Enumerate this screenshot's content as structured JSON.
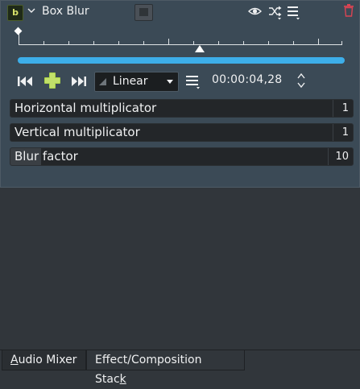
{
  "effect": {
    "badge": "b",
    "title": "Box Blur"
  },
  "keyframes": {
    "interpolation": "Linear",
    "timecode": "00:00:04,28",
    "position_fraction": 0.56
  },
  "params": [
    {
      "name": "Horizontal multiplicator",
      "value": "1",
      "fraction": 0.0
    },
    {
      "name": "Vertical multiplicator",
      "value": "1",
      "fraction": 0.0
    },
    {
      "name": "Blur factor",
      "value": "10",
      "fraction": 0.09
    }
  ],
  "tabs": [
    {
      "label": "Audio Mixer",
      "accel": "A",
      "rest": "udio Mixer"
    },
    {
      "label": "Effect/Composition Stack",
      "prefix": "Effect/Composition Stac",
      "accel": "k"
    }
  ],
  "colors": {
    "panel": "#3b4a56",
    "accent": "#3daee9",
    "background": "#31363b"
  },
  "icons": {
    "collapse": "chevron-down-icon",
    "compare": "compare-split-icon",
    "visibility": "eye-icon",
    "presets": "shuffle-icon",
    "menu": "hamburger-menu-icon",
    "delete": "trash-icon",
    "prev_keyframe": "previous-keyframe-icon",
    "add_keyframe": "add-keyframe-icon",
    "next_keyframe": "next-keyframe-icon",
    "keyframe_options": "options-menu-icon"
  }
}
